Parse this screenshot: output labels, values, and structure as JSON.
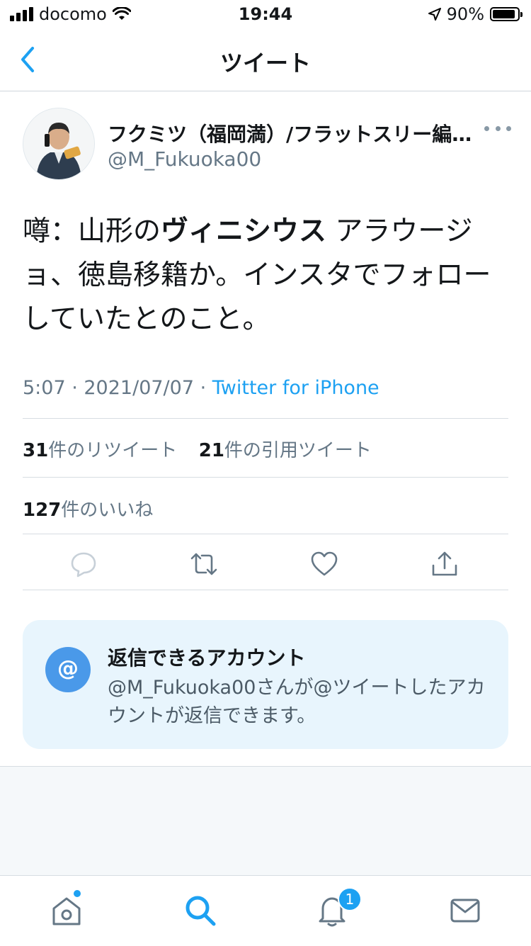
{
  "status_bar": {
    "carrier": "docomo",
    "time": "19:44",
    "battery": "90%",
    "battery_level": 0.9
  },
  "nav": {
    "title": "ツイート"
  },
  "author": {
    "name": "フクミツ（福岡満）/フラットスリー編集部",
    "handle": "@M_Fukuoka00"
  },
  "tweet": {
    "text_before": "噂：山形の",
    "text_bold": "ヴィニシウス",
    "text_after": " アラウージョ、徳島移籍か。インスタでフォローしていたとのこと。",
    "time_date": "5:07 · 2021/07/07 · ",
    "source": "Twitter for iPhone"
  },
  "stats": {
    "retweets_count": "31",
    "retweets_label": "件のリツイート",
    "quotes_count": "21",
    "quotes_label": "件の引用ツイート",
    "likes_count": "127",
    "likes_label": "件のいいね"
  },
  "reply_info": {
    "icon_char": "@",
    "title": "返信できるアカウント",
    "description": "@M_Fukuoka00さんが@ツイートしたアカウントが返信できます。"
  },
  "tab_bar": {
    "notifications_badge": "1"
  },
  "colors": {
    "accent": "#1da1f2",
    "icon_gray": "#657786",
    "reply_card_bg": "#e8f5fd"
  }
}
